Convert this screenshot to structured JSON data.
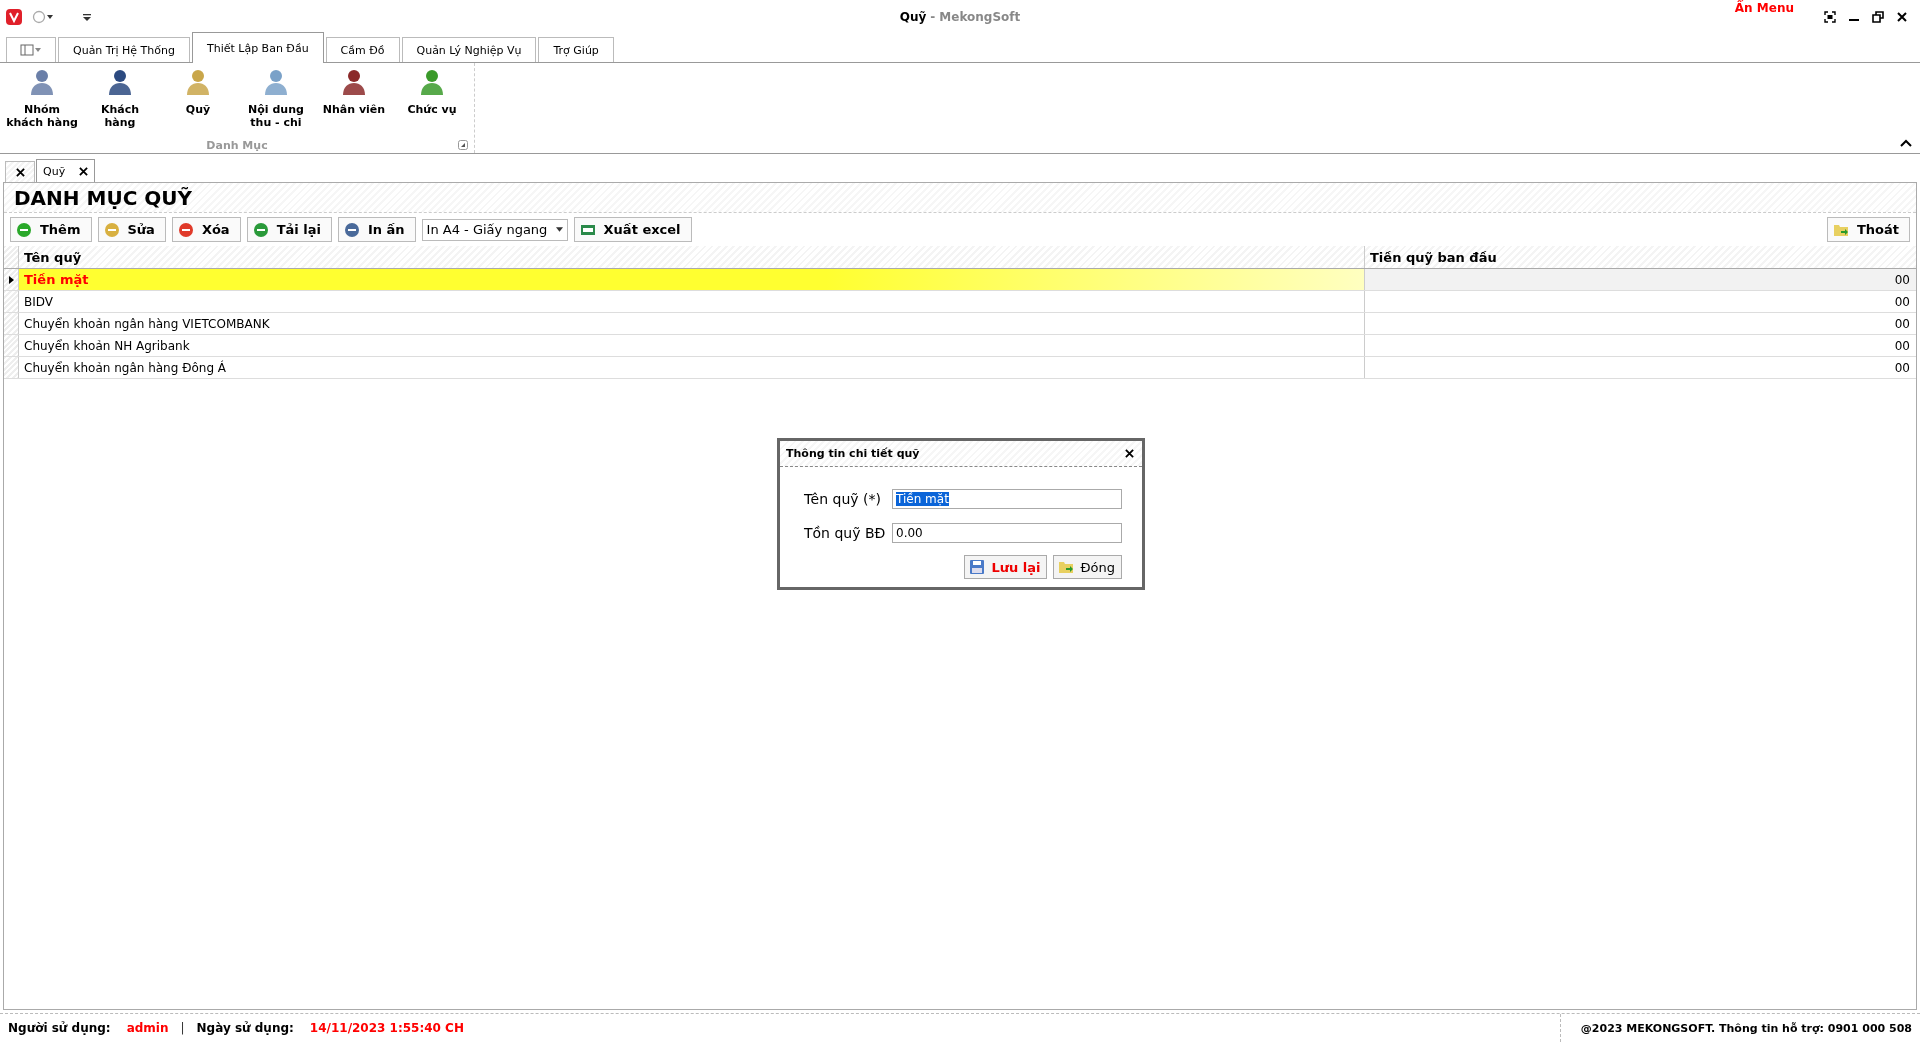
{
  "window": {
    "title": "Quỹ",
    "subtitle": "- MekongSoft",
    "hide_menu": "Ẩn Menu"
  },
  "ribbon_tabs": [
    {
      "label": "Quản Trị Hệ Thống",
      "selected": false
    },
    {
      "label": "Thiết Lập Ban Đầu",
      "selected": true
    },
    {
      "label": "Cầm Đồ",
      "selected": false
    },
    {
      "label": "Quản Lý Nghiệp Vụ",
      "selected": false
    },
    {
      "label": "Trợ Giúp",
      "selected": false
    }
  ],
  "ribbon_group": {
    "title": "Danh Mục",
    "items": [
      {
        "label": "Nhóm khách hàng",
        "kind": "group"
      },
      {
        "label": "Khách hàng",
        "kind": "customer"
      },
      {
        "label": "Quỹ",
        "kind": "money"
      },
      {
        "label": "Nội dung thu - chi",
        "kind": "notes"
      },
      {
        "label": "Nhân viên",
        "kind": "staff"
      },
      {
        "label": "Chức vụ",
        "kind": "position"
      }
    ]
  },
  "doc_tabs": [
    {
      "label": "Quỹ",
      "selected": true
    }
  ],
  "page": {
    "heading": "DANH MỤC QUỸ"
  },
  "toolbar": {
    "buttons": [
      {
        "label": "Thêm",
        "kind": "add"
      },
      {
        "label": "Sửa",
        "kind": "edit"
      },
      {
        "label": "Xóa",
        "kind": "delete"
      },
      {
        "label": "Tải lại",
        "kind": "reload"
      },
      {
        "label": "In ấn",
        "kind": "print"
      }
    ],
    "print_format": "In A4 - Giấy ngang",
    "export": "Xuất excel",
    "exit": "Thoát"
  },
  "table": {
    "columns": [
      "Tên quỹ",
      "Tiền quỹ ban đầu"
    ],
    "rows": [
      {
        "name": "Tiền mặt",
        "amount": "00",
        "selected": true
      },
      {
        "name": "BIDV",
        "amount": "00",
        "selected": false
      },
      {
        "name": "Chuyển khoản ngân hàng VIETCOMBANK",
        "amount": "00",
        "selected": false
      },
      {
        "name": "Chuyển khoản NH Agribank",
        "amount": "00",
        "selected": false
      },
      {
        "name": "Chuyển khoản ngân hàng Đông Á",
        "amount": "00",
        "selected": false
      }
    ]
  },
  "dialog": {
    "title": "Thông tin chi tiết quỹ",
    "fields": [
      {
        "label": "Tên quỹ (*)",
        "value": "Tiền mặt",
        "selected": true
      },
      {
        "label": "Tồn quỹ BĐ",
        "value": "0.00",
        "selected": false
      }
    ],
    "save": "Lưu lại",
    "close": "Đóng"
  },
  "status_bar": {
    "user_label": "Người sử dụng:",
    "user": "admin",
    "separator": "|",
    "date_label": "Ngày sử dụng:",
    "date": "14/11/2023 1:55:40 CH",
    "copyright": "@2023 MEKONGSOFT. Thông tin hỗ trợ: 0901 000 508"
  }
}
